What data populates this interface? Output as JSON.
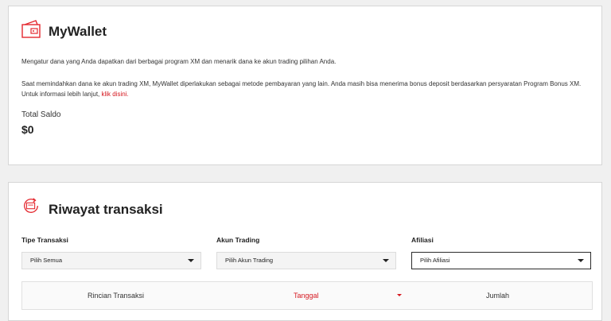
{
  "wallet": {
    "icon": "wallet-icon",
    "title": "MyWallet",
    "description": "Mengatur dana yang Anda dapatkan dari berbagai program XM dan menarik dana ke akun trading pilihan Anda.",
    "note": "Saat memindahkan dana ke akun trading XM, MyWallet diperlakukan sebagai metode pembayaran yang lain. Anda masih bisa menerima bonus deposit berdasarkan persyaratan Program Bonus XM. Untuk informasi lebih lanjut, ",
    "note_link": "klik disini.",
    "total_label": "Total Saldo",
    "total_value": "$0"
  },
  "history": {
    "icon": "transaction-history-icon",
    "title": "Riwayat transaksi",
    "filters": {
      "type_label": "Tipe Transaksi",
      "type_value": "Pilih Semua",
      "account_label": "Akun Trading",
      "account_value": "Pilih Akun Trading",
      "affiliate_label": "Afiliasi",
      "affiliate_value": "Pilih Afiliasi"
    },
    "table": {
      "columns": [
        "Rincian Transaksi",
        "Tanggal",
        "Jumlah"
      ]
    }
  },
  "colors": {
    "accent": "#d51820",
    "background": "#f0f0f0"
  }
}
